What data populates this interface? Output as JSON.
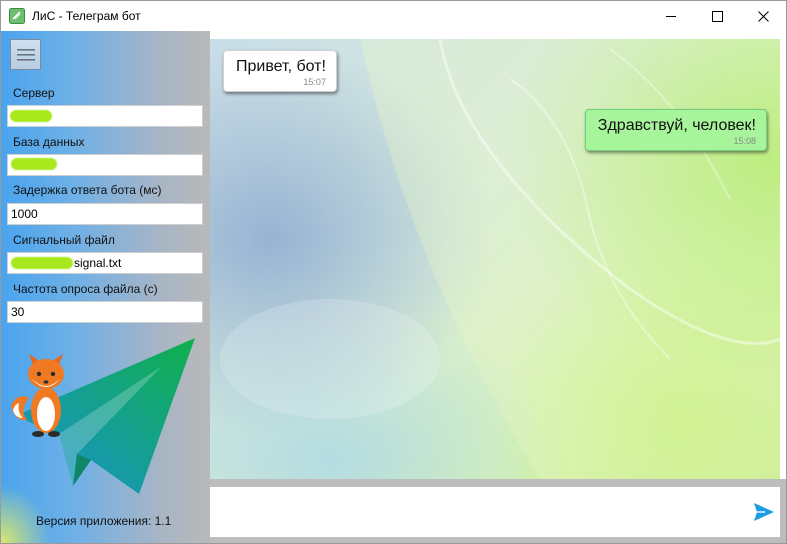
{
  "window": {
    "title": "ЛиС - Телеграм бот",
    "controls": {
      "minimize": "minimize-icon",
      "maximize": "maximize-icon",
      "close": "close-icon"
    }
  },
  "sidebar": {
    "menu_icon": "hamburger-icon",
    "fields": [
      {
        "label": "Сервер",
        "value": ""
      },
      {
        "label": "База данных",
        "value": ""
      },
      {
        "label": "Задержка ответа бота (мс)",
        "value": "1000"
      },
      {
        "label": "Сигнальный файл",
        "value": "signal.txt"
      },
      {
        "label": "Частота опроса файла (с)",
        "value": "30"
      }
    ],
    "version": "Версия приложения: 1.1"
  },
  "chat": {
    "messages": [
      {
        "direction": "incoming",
        "text": "Привет, бот!",
        "time": "15:07"
      },
      {
        "direction": "outgoing",
        "text": "Здравствуй, человек!",
        "time": "15:08"
      }
    ]
  },
  "composer": {
    "value": "",
    "send_icon": "send-icon"
  },
  "colors": {
    "accent_send": "#1e9be6",
    "outgoing_bubble": "#a7f59a",
    "incoming_bubble": "#ffffff",
    "telegram_plane_start": "#1a8fd6",
    "telegram_plane_end": "#0fb04a"
  }
}
